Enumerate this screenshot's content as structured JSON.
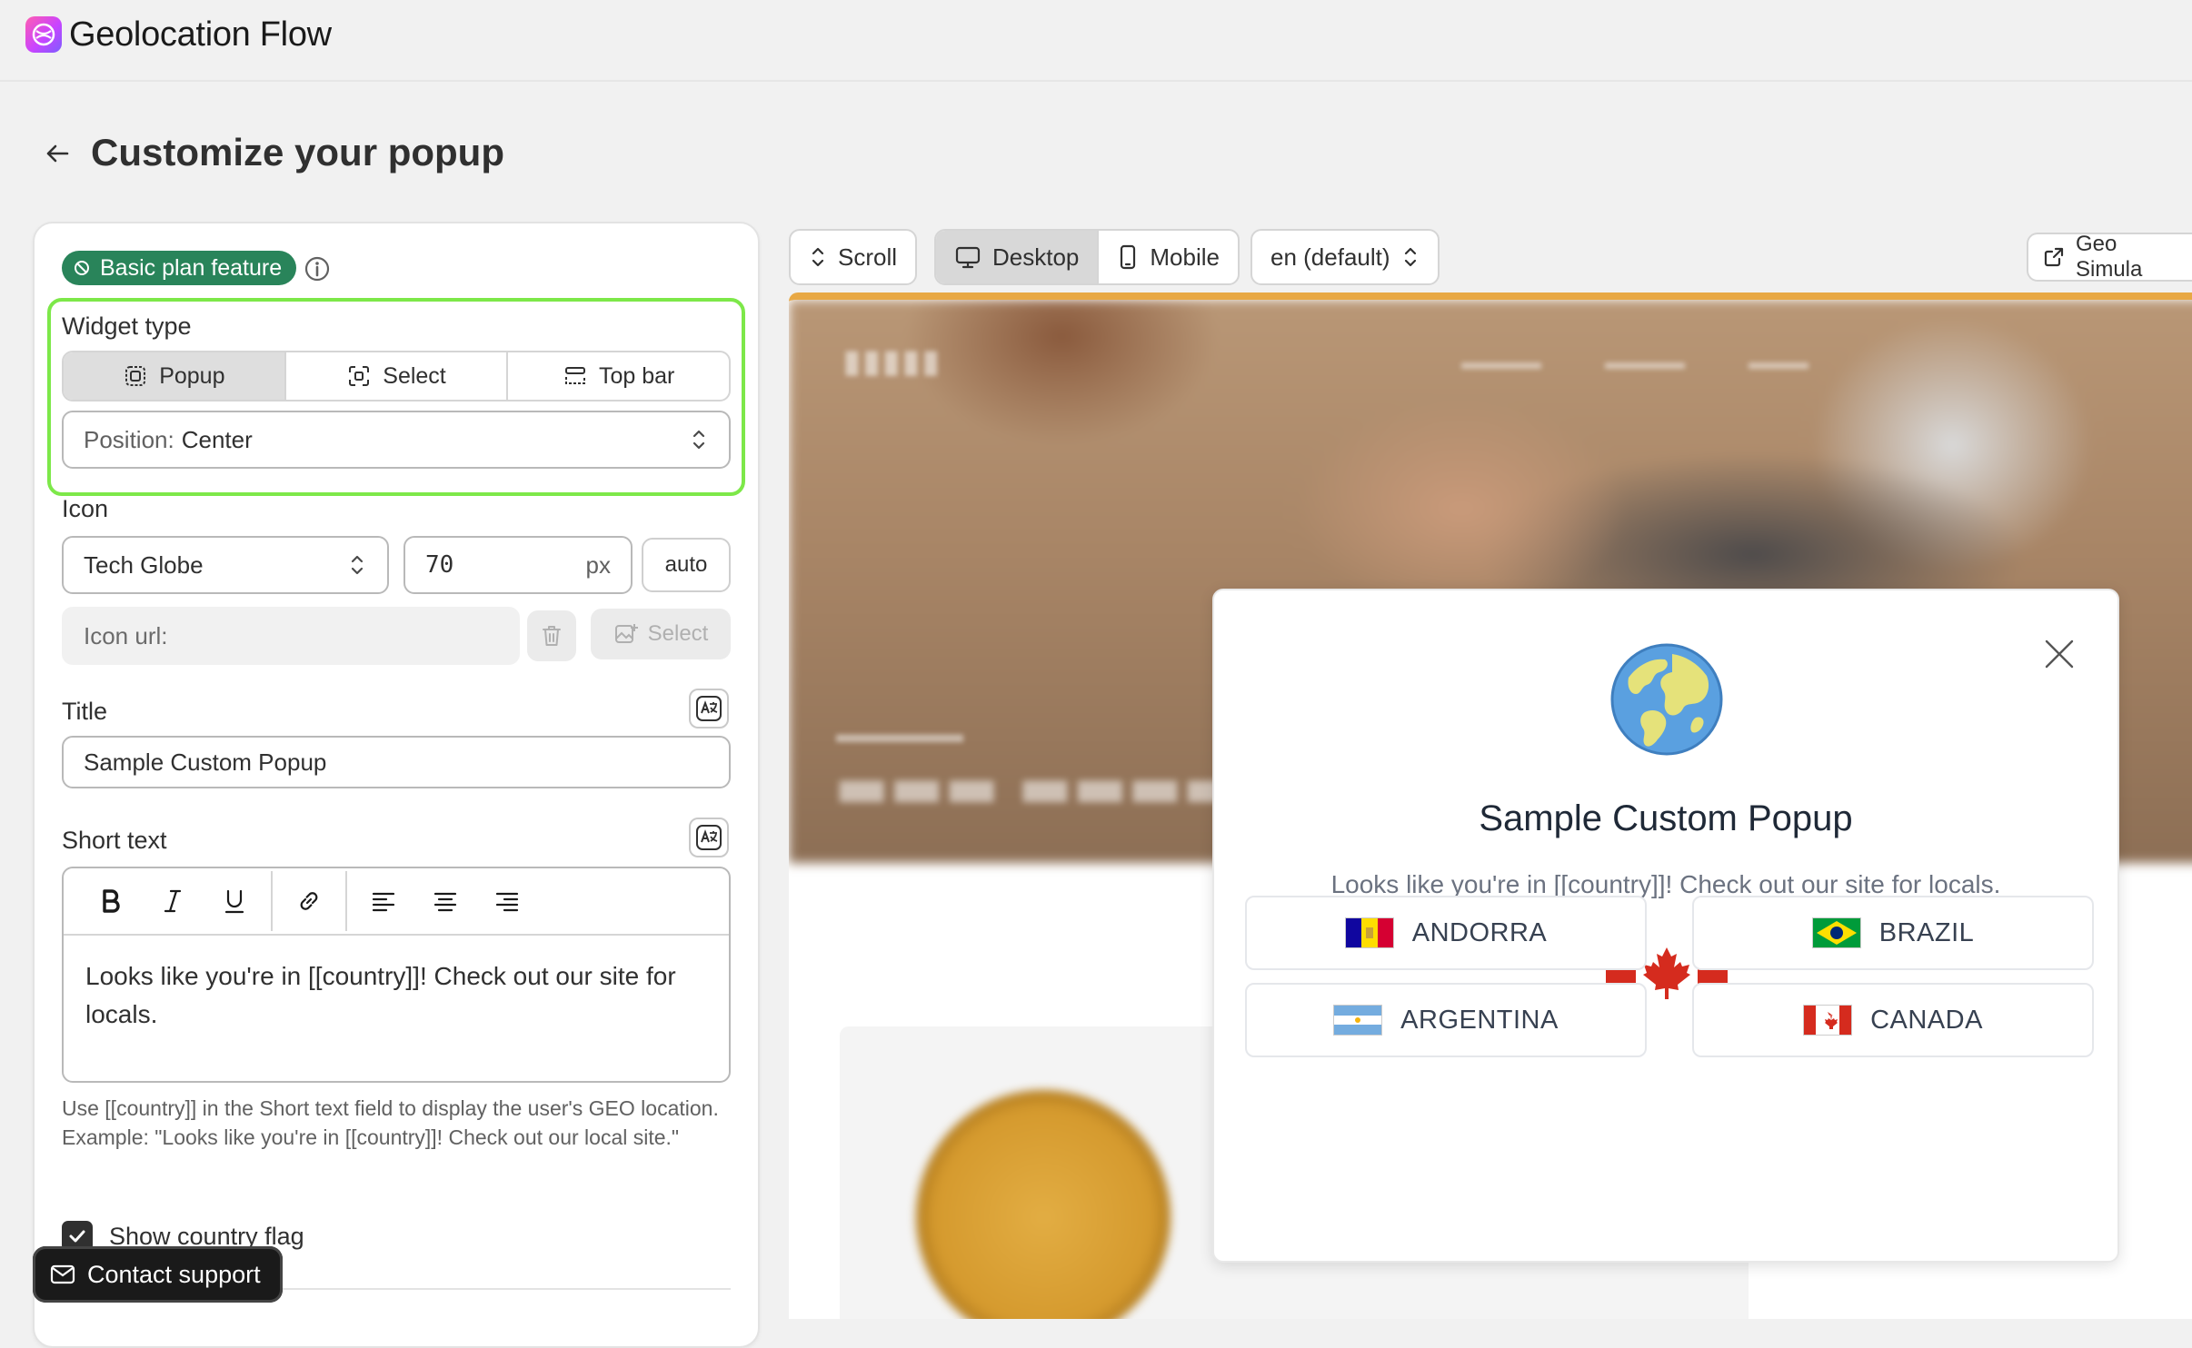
{
  "app": {
    "title": "Geolocation Flow"
  },
  "page": {
    "title": "Customize your popup"
  },
  "settings": {
    "plan_badge": "Basic plan feature",
    "widget_type": {
      "label": "Widget type",
      "options": [
        "Popup",
        "Select",
        "Top bar"
      ],
      "selected": "Popup"
    },
    "position": {
      "label": "Position:",
      "value": "Center"
    },
    "icon": {
      "label": "Icon",
      "selected": "Tech Globe",
      "size_value": "70",
      "size_unit": "px",
      "auto_label": "auto",
      "url_label": "Icon url:",
      "select_label": "Select"
    },
    "title": {
      "label": "Title",
      "value": "Sample Custom Popup"
    },
    "short_text": {
      "label": "Short text",
      "value": "Looks like you're in [[country]]! Check out our site for locals.",
      "help": "Use [[country]] in the Short text field to display the user's GEO location. Example: \"Looks like you're in [[country]]! Check out our local site.\""
    },
    "show_flag": {
      "label": "Show country flag",
      "checked": true
    }
  },
  "contact_support": "Contact support",
  "preview": {
    "scroll_label": "Scroll",
    "desktop_label": "Desktop",
    "mobile_label": "Mobile",
    "language": "en (default)",
    "geo_sim_label": "Geo Simula"
  },
  "popup": {
    "title": "Sample Custom Popup",
    "text": "Looks like you're in [[country]]! Check out our site for locals.",
    "countries": [
      "ANDORRA",
      "BRAZIL",
      "ARGENTINA",
      "CANADA"
    ]
  },
  "colors": {
    "accent_green": "#29845a",
    "highlight_outline": "#7de849",
    "preview_top_border": "#e8a844",
    "flag_red": "#d52b1e"
  }
}
